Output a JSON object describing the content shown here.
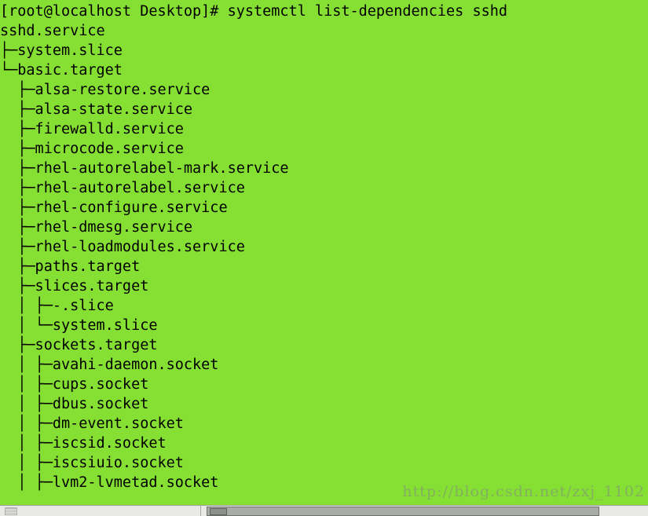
{
  "terminal": {
    "background_color": "#85e033",
    "text_color": "#000000",
    "prompt": "[root@localhost Desktop]#",
    "command": "systemctl list-dependencies sshd",
    "prompt_line": "[root@localhost Desktop]# systemctl list-dependencies sshd",
    "lines": [
      "[root@localhost Desktop]# systemctl list-dependencies sshd",
      "sshd.service",
      "├─system.slice",
      "└─basic.target",
      "  ├─alsa-restore.service",
      "  ├─alsa-state.service",
      "  ├─firewalld.service",
      "  ├─microcode.service",
      "  ├─rhel-autorelabel-mark.service",
      "  ├─rhel-autorelabel.service",
      "  ├─rhel-configure.service",
      "  ├─rhel-dmesg.service",
      "  ├─rhel-loadmodules.service",
      "  ├─paths.target",
      "  ├─slices.target",
      "  │ ├─-.slice",
      "  │ └─system.slice",
      "  ├─sockets.target",
      "  │ ├─avahi-daemon.socket",
      "  │ ├─cups.socket",
      "  │ ├─dbus.socket",
      "  │ ├─dm-event.socket",
      "  │ ├─iscsid.socket",
      "  │ ├─iscsiuio.socket",
      "  │ ├─lvm2-lvmetad.socket"
    ],
    "units": [
      {
        "name": "sshd.service",
        "depth": 0
      },
      {
        "name": "system.slice",
        "depth": 1
      },
      {
        "name": "basic.target",
        "depth": 1
      },
      {
        "name": "alsa-restore.service",
        "depth": 2
      },
      {
        "name": "alsa-state.service",
        "depth": 2
      },
      {
        "name": "firewalld.service",
        "depth": 2
      },
      {
        "name": "microcode.service",
        "depth": 2
      },
      {
        "name": "rhel-autorelabel-mark.service",
        "depth": 2
      },
      {
        "name": "rhel-autorelabel.service",
        "depth": 2
      },
      {
        "name": "rhel-configure.service",
        "depth": 2
      },
      {
        "name": "rhel-dmesg.service",
        "depth": 2
      },
      {
        "name": "rhel-loadmodules.service",
        "depth": 2
      },
      {
        "name": "paths.target",
        "depth": 2
      },
      {
        "name": "slices.target",
        "depth": 2
      },
      {
        "name": "-.slice",
        "depth": 3
      },
      {
        "name": "system.slice",
        "depth": 3
      },
      {
        "name": "sockets.target",
        "depth": 2
      },
      {
        "name": "avahi-daemon.socket",
        "depth": 3
      },
      {
        "name": "cups.socket",
        "depth": 3
      },
      {
        "name": "dbus.socket",
        "depth": 3
      },
      {
        "name": "dm-event.socket",
        "depth": 3
      },
      {
        "name": "iscsid.socket",
        "depth": 3
      },
      {
        "name": "iscsiuio.socket",
        "depth": 3
      },
      {
        "name": "lvm2-lvmetad.socket",
        "depth": 3
      }
    ]
  },
  "watermark": {
    "text": "http://blog.csdn.net/zxj_1102"
  },
  "taskbar": {
    "launcher_hint": "",
    "window_button_label": ""
  }
}
